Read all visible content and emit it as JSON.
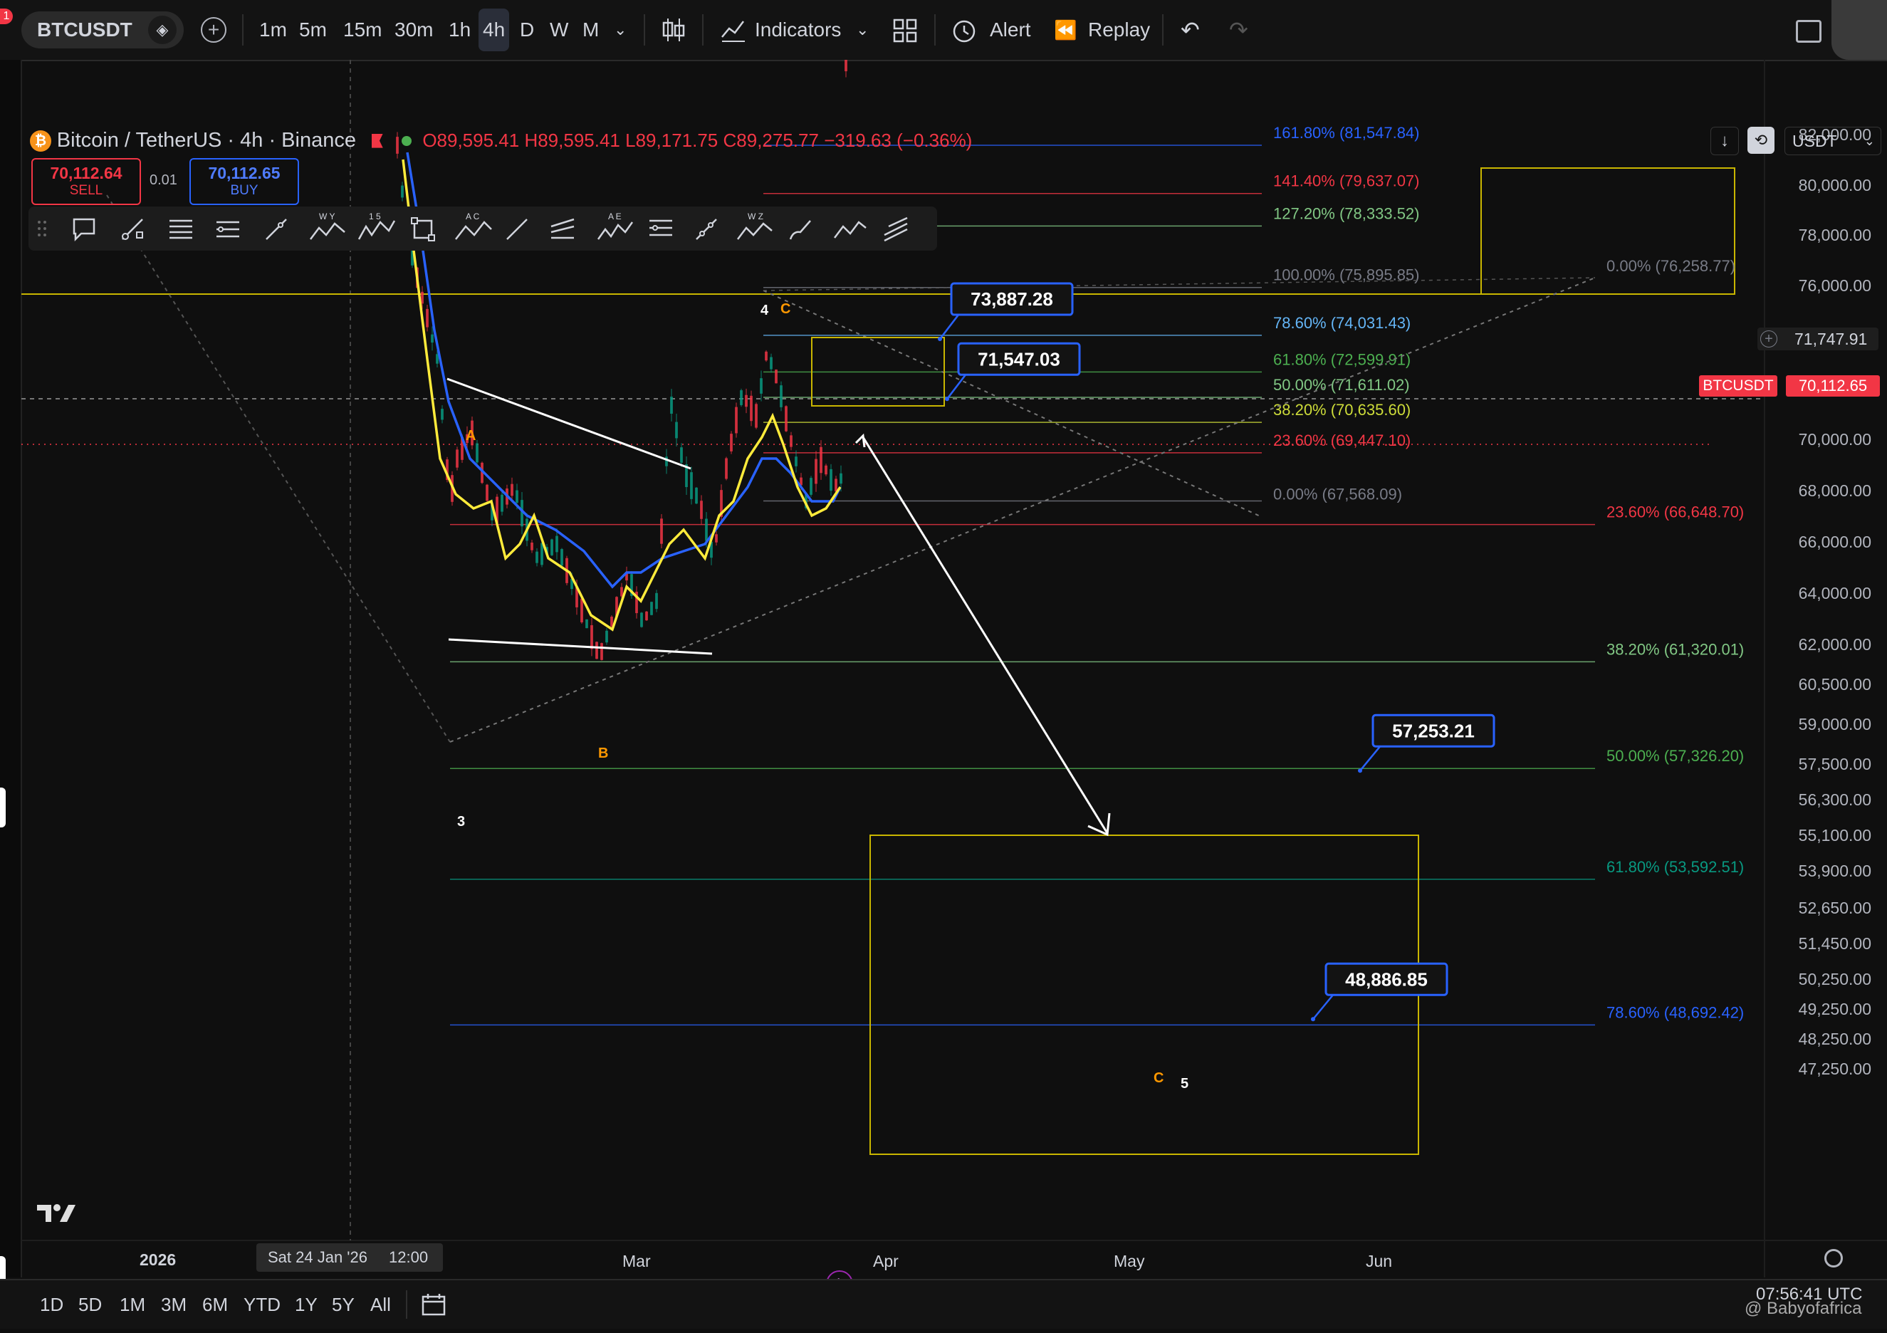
{
  "toolbar": {
    "symbol": "BTCUSDT",
    "notification_count": "1",
    "timeframes": [
      "1m",
      "5m",
      "15m",
      "30m",
      "1h",
      "4h",
      "D",
      "W",
      "M"
    ],
    "active_timeframe": "4h",
    "indicators_label": "Indicators",
    "alert_label": "Alert",
    "replay_label": "Replay"
  },
  "legend": {
    "title": "Bitcoin / TetherUS · 4h · Binance",
    "open": "O89,595.41",
    "high": "H89,595.41",
    "low": "L89,171.75",
    "close": "C89,275.77",
    "change": "−319.63 (−0.36%)",
    "sell_price": "70,112.64",
    "sell_label": "SELL",
    "spread": "0.01",
    "buy_price": "70,112.65",
    "buy_label": "BUY"
  },
  "price_scale": {
    "currency": "USDT",
    "crosshair_price": "71,747.91",
    "last_symbol": "BTCUSDT",
    "last_price": "70,112.65"
  },
  "chart_data": {
    "type": "line",
    "title": "Bitcoin / TetherUS · 4h · Binance",
    "y_ticks": [
      82000,
      80000,
      78000,
      76000,
      74000,
      72000,
      70000,
      68000,
      66000,
      64000,
      62000,
      60500,
      59000,
      57500,
      56300,
      55100,
      53900,
      52650,
      51450,
      50250,
      49250,
      48250,
      47250
    ],
    "y_tick_labels": [
      "82,000.00",
      "80,000.00",
      "78,000.00",
      "76,000.00",
      "74,000.00",
      "72,000.00",
      "70,000.00",
      "68,000.00",
      "66,000.00",
      "64,000.00",
      "62,000.00",
      "60,500.00",
      "59,000.00",
      "57,500.00",
      "56,300.00",
      "55,100.00",
      "53,900.00",
      "52,650.00",
      "51,450.00",
      "50,250.00",
      "49,250.00",
      "48,250.00",
      "47,250.00"
    ],
    "x_labels": [
      "2026",
      "Sat 24 Jan '26",
      "12:00",
      "Mar",
      "Apr",
      "May",
      "Jun"
    ],
    "fib_upper": [
      {
        "label": "161.80% (81,547.84)",
        "value": 81547.84,
        "color": "#2962ff"
      },
      {
        "label": "141.40% (79,637.07)",
        "value": 79637.07,
        "color": "#f23645"
      },
      {
        "label": "127.20% (78,333.52)",
        "value": 78333.52,
        "color": "#81c784"
      },
      {
        "label": "100.00% (75,895.85)",
        "value": 75895.85,
        "color": "#787b86"
      },
      {
        "label": "78.60% (74,031.43)",
        "value": 74031.43,
        "color": "#64b5f6"
      },
      {
        "label": "61.80% (72,599.91)",
        "value": 72599.91,
        "color": "#4caf50"
      },
      {
        "label": "50.00% (71,611.02)",
        "value": 71611.02,
        "color": "#81c784"
      },
      {
        "label": "38.20% (70,635.60)",
        "value": 70635.6,
        "color": "#cddc39"
      },
      {
        "label": "23.60% (69,447.10)",
        "value": 69447.1,
        "color": "#f23645"
      },
      {
        "label": "0.00% (67,568.09)",
        "value": 67568.09,
        "color": "#787b86"
      }
    ],
    "fib_lower": [
      {
        "label": "0.00% (76,258.77)",
        "value": 76258.77,
        "color": "#787b86"
      },
      {
        "label": "23.60% (66,648.70)",
        "value": 66648.7,
        "color": "#f23645"
      },
      {
        "label": "38.20% (61,320.01)",
        "value": 61320.01,
        "color": "#81c784"
      },
      {
        "label": "50.00% (57,326.20)",
        "value": 57326.2,
        "color": "#4caf50"
      },
      {
        "label": "61.80% (53,592.51)",
        "value": 53592.51,
        "color": "#089981"
      },
      {
        "label": "78.60% (48,692.42)",
        "value": 48692.42,
        "color": "#2962ff"
      }
    ],
    "callouts": [
      {
        "label": "73,887.28",
        "value": 73887.28
      },
      {
        "label": "71,547.03",
        "value": 71547.03
      },
      {
        "label": "57,253.21",
        "value": 57253.21
      },
      {
        "label": "48,886.85",
        "value": 48886.85
      }
    ],
    "wave_labels": [
      {
        "text": "4",
        "color": "#ffffff"
      },
      {
        "text": "C",
        "color": "#ff9800"
      },
      {
        "text": "A",
        "color": "#ff9800"
      },
      {
        "text": "B",
        "color": "#ff9800"
      },
      {
        "text": "3",
        "color": "#ffffff"
      },
      {
        "text": "C",
        "color": "#ff9800"
      },
      {
        "text": "5",
        "color": "#ffffff"
      }
    ],
    "series": [
      {
        "color": "#ffeb3b"
      },
      {
        "color": "#2962ff"
      }
    ]
  },
  "bottombar": {
    "ranges": [
      "1D",
      "5D",
      "1M",
      "3M",
      "6M",
      "YTD",
      "1Y",
      "5Y",
      "All"
    ],
    "clock": "07:56:41 UTC",
    "watermark": "@ Babyofafrica"
  }
}
